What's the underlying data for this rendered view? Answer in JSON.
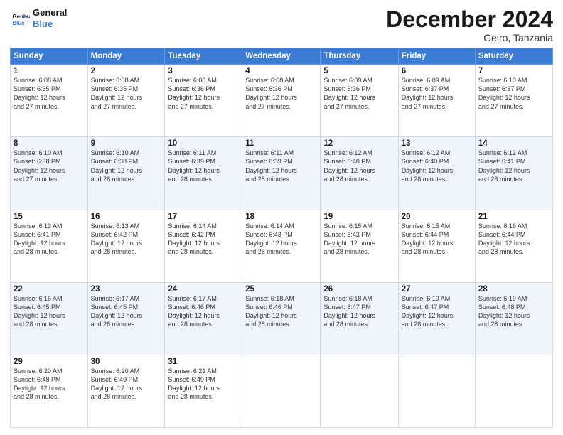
{
  "header": {
    "logo_line1": "General",
    "logo_line2": "Blue",
    "month": "December 2024",
    "location": "Geiro, Tanzania"
  },
  "weekdays": [
    "Sunday",
    "Monday",
    "Tuesday",
    "Wednesday",
    "Thursday",
    "Friday",
    "Saturday"
  ],
  "weeks": [
    [
      {
        "day": "1",
        "info": "Sunrise: 6:08 AM\nSunset: 6:35 PM\nDaylight: 12 hours\nand 27 minutes."
      },
      {
        "day": "2",
        "info": "Sunrise: 6:08 AM\nSunset: 6:35 PM\nDaylight: 12 hours\nand 27 minutes."
      },
      {
        "day": "3",
        "info": "Sunrise: 6:08 AM\nSunset: 6:36 PM\nDaylight: 12 hours\nand 27 minutes."
      },
      {
        "day": "4",
        "info": "Sunrise: 6:08 AM\nSunset: 6:36 PM\nDaylight: 12 hours\nand 27 minutes."
      },
      {
        "day": "5",
        "info": "Sunrise: 6:09 AM\nSunset: 6:36 PM\nDaylight: 12 hours\nand 27 minutes."
      },
      {
        "day": "6",
        "info": "Sunrise: 6:09 AM\nSunset: 6:37 PM\nDaylight: 12 hours\nand 27 minutes."
      },
      {
        "day": "7",
        "info": "Sunrise: 6:10 AM\nSunset: 6:37 PM\nDaylight: 12 hours\nand 27 minutes."
      }
    ],
    [
      {
        "day": "8",
        "info": "Sunrise: 6:10 AM\nSunset: 6:38 PM\nDaylight: 12 hours\nand 27 minutes."
      },
      {
        "day": "9",
        "info": "Sunrise: 6:10 AM\nSunset: 6:38 PM\nDaylight: 12 hours\nand 28 minutes."
      },
      {
        "day": "10",
        "info": "Sunrise: 6:11 AM\nSunset: 6:39 PM\nDaylight: 12 hours\nand 28 minutes."
      },
      {
        "day": "11",
        "info": "Sunrise: 6:11 AM\nSunset: 6:39 PM\nDaylight: 12 hours\nand 28 minutes."
      },
      {
        "day": "12",
        "info": "Sunrise: 6:12 AM\nSunset: 6:40 PM\nDaylight: 12 hours\nand 28 minutes."
      },
      {
        "day": "13",
        "info": "Sunrise: 6:12 AM\nSunset: 6:40 PM\nDaylight: 12 hours\nand 28 minutes."
      },
      {
        "day": "14",
        "info": "Sunrise: 6:12 AM\nSunset: 6:41 PM\nDaylight: 12 hours\nand 28 minutes."
      }
    ],
    [
      {
        "day": "15",
        "info": "Sunrise: 6:13 AM\nSunset: 6:41 PM\nDaylight: 12 hours\nand 28 minutes."
      },
      {
        "day": "16",
        "info": "Sunrise: 6:13 AM\nSunset: 6:42 PM\nDaylight: 12 hours\nand 28 minutes."
      },
      {
        "day": "17",
        "info": "Sunrise: 6:14 AM\nSunset: 6:42 PM\nDaylight: 12 hours\nand 28 minutes."
      },
      {
        "day": "18",
        "info": "Sunrise: 6:14 AM\nSunset: 6:43 PM\nDaylight: 12 hours\nand 28 minutes."
      },
      {
        "day": "19",
        "info": "Sunrise: 6:15 AM\nSunset: 6:43 PM\nDaylight: 12 hours\nand 28 minutes."
      },
      {
        "day": "20",
        "info": "Sunrise: 6:15 AM\nSunset: 6:44 PM\nDaylight: 12 hours\nand 28 minutes."
      },
      {
        "day": "21",
        "info": "Sunrise: 6:16 AM\nSunset: 6:44 PM\nDaylight: 12 hours\nand 28 minutes."
      }
    ],
    [
      {
        "day": "22",
        "info": "Sunrise: 6:16 AM\nSunset: 6:45 PM\nDaylight: 12 hours\nand 28 minutes."
      },
      {
        "day": "23",
        "info": "Sunrise: 6:17 AM\nSunset: 6:45 PM\nDaylight: 12 hours\nand 28 minutes."
      },
      {
        "day": "24",
        "info": "Sunrise: 6:17 AM\nSunset: 6:46 PM\nDaylight: 12 hours\nand 28 minutes."
      },
      {
        "day": "25",
        "info": "Sunrise: 6:18 AM\nSunset: 6:46 PM\nDaylight: 12 hours\nand 28 minutes."
      },
      {
        "day": "26",
        "info": "Sunrise: 6:18 AM\nSunset: 6:47 PM\nDaylight: 12 hours\nand 28 minutes."
      },
      {
        "day": "27",
        "info": "Sunrise: 6:19 AM\nSunset: 6:47 PM\nDaylight: 12 hours\nand 28 minutes."
      },
      {
        "day": "28",
        "info": "Sunrise: 6:19 AM\nSunset: 6:48 PM\nDaylight: 12 hours\nand 28 minutes."
      }
    ],
    [
      {
        "day": "29",
        "info": "Sunrise: 6:20 AM\nSunset: 6:48 PM\nDaylight: 12 hours\nand 28 minutes."
      },
      {
        "day": "30",
        "info": "Sunrise: 6:20 AM\nSunset: 6:49 PM\nDaylight: 12 hours\nand 28 minutes."
      },
      {
        "day": "31",
        "info": "Sunrise: 6:21 AM\nSunset: 6:49 PM\nDaylight: 12 hours\nand 28 minutes."
      },
      null,
      null,
      null,
      null
    ]
  ]
}
